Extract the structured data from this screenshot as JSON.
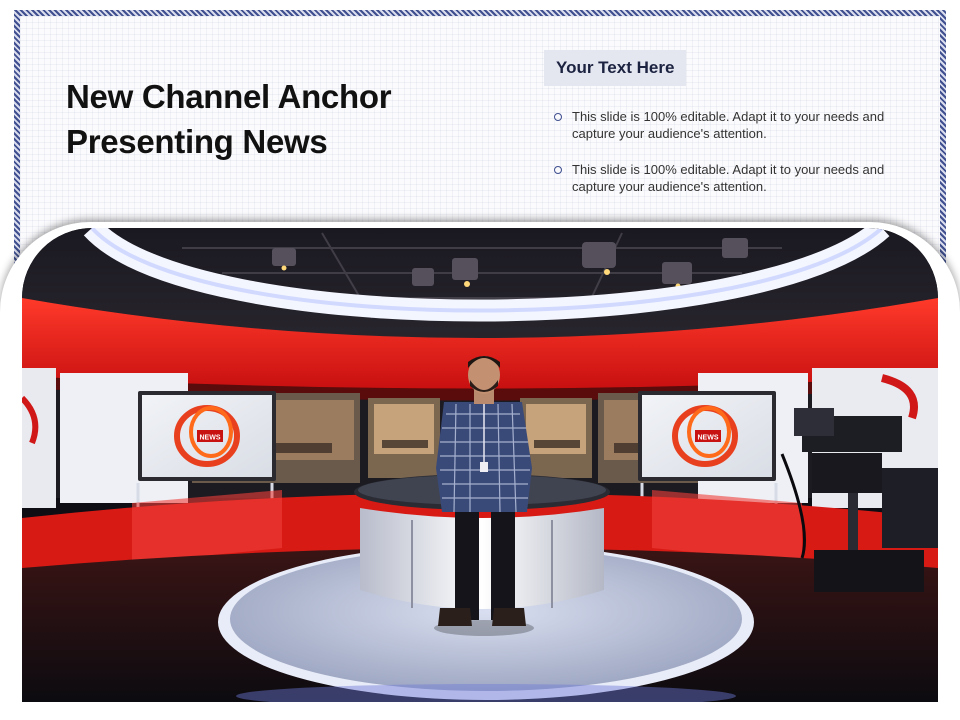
{
  "slide": {
    "title": "New Channel Anchor Presenting News",
    "tag": "Your Text Here",
    "bullets": [
      "This slide is 100% editable. Adapt it to your needs and capture your audience's attention.",
      "This slide is 100% editable. Adapt it to your needs and capture your audience's attention."
    ]
  },
  "photo": {
    "screen_logo_text": "NEWS",
    "colors": {
      "accent_red": "#e21e1e",
      "frame_blue": "#3f4f8f",
      "ring_white": "#f4f6ff"
    }
  }
}
